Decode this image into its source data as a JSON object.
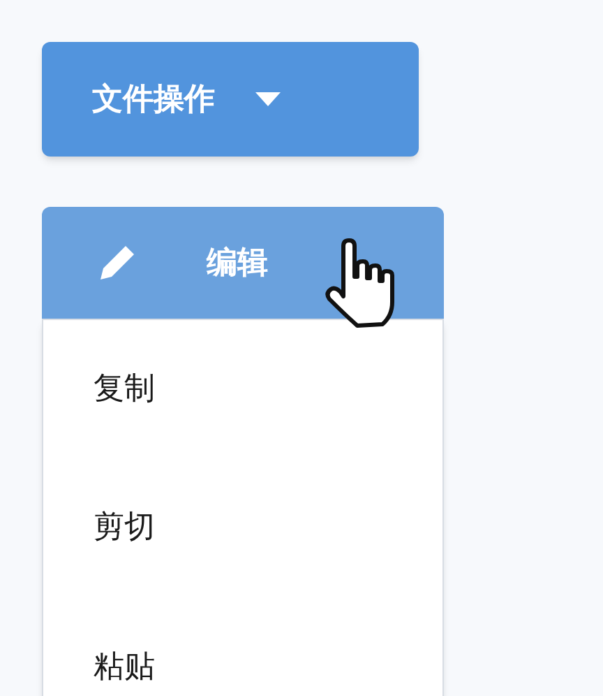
{
  "file_menu": {
    "label": "文件操作",
    "expanded": false
  },
  "edit_menu": {
    "label": "编辑",
    "hovered": true,
    "expanded": true,
    "items": [
      {
        "label": "复制"
      },
      {
        "label": "剪切"
      },
      {
        "label": "粘贴"
      }
    ]
  }
}
